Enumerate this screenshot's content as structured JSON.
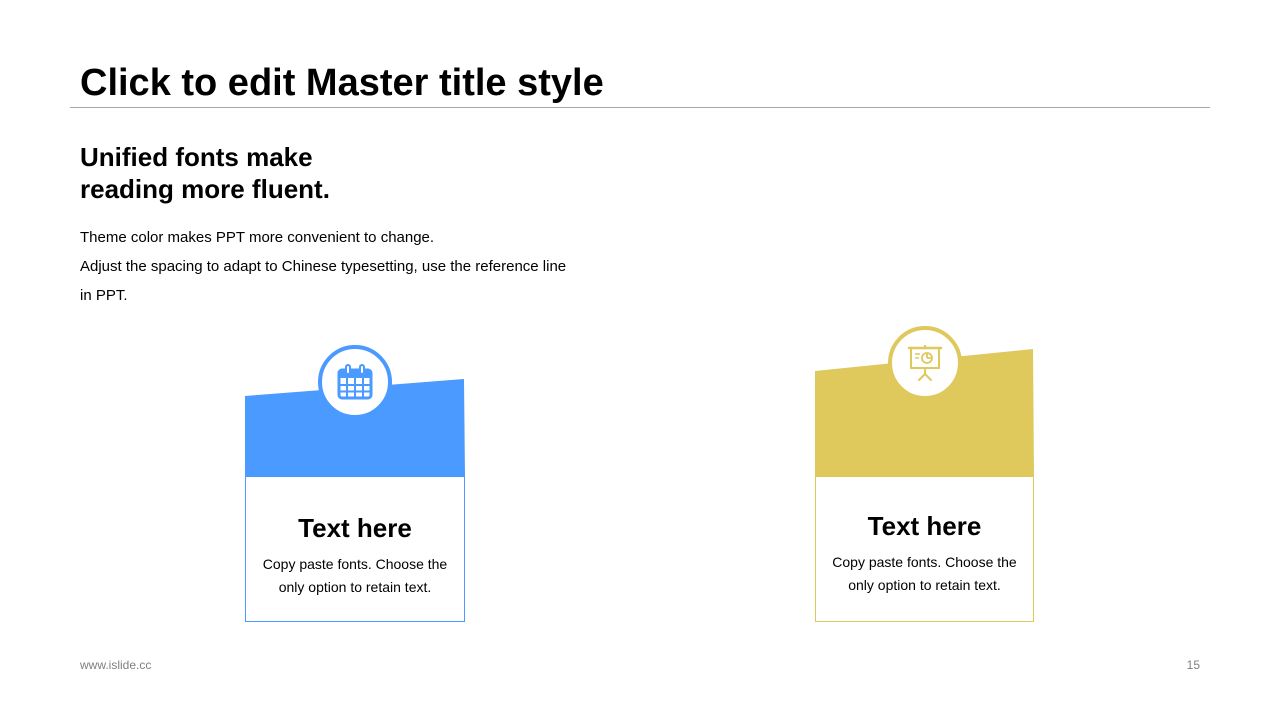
{
  "slide": {
    "title": "Click to edit Master title style",
    "subheading_lines": [
      "Unified fonts make",
      "reading more fluent."
    ],
    "body_lines": [
      "Theme color makes PPT more convenient to change.",
      "Adjust the spacing to adapt to Chinese typesetting, use the reference line",
      "in PPT."
    ]
  },
  "cards": [
    {
      "heading": "Text here",
      "text_lines": [
        "Copy paste fonts. Choose the",
        "only option to retain text."
      ],
      "icon": "calendar-icon",
      "color": "#4A9AFF"
    },
    {
      "heading": "Text here",
      "text_lines": [
        "Copy paste fonts. Choose the",
        "only option to retain text."
      ],
      "icon": "presentation-board-icon",
      "color": "#DFC85C"
    }
  ],
  "footer": {
    "website": "www.islide.cc",
    "page_number": "15"
  }
}
